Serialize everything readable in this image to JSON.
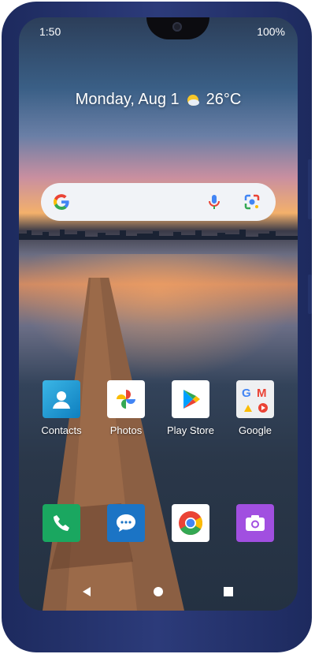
{
  "status_bar": {
    "time": "1:50",
    "battery": "100%"
  },
  "widget": {
    "date": "Monday, Aug 1",
    "temperature": "26°C",
    "weather_icon": "partly-sunny-icon"
  },
  "search_bar": {
    "icons": [
      "google-g-icon",
      "mic-icon",
      "google-lens-icon"
    ]
  },
  "home_apps": [
    {
      "label": "Contacts",
      "icon": "contacts-icon"
    },
    {
      "label": "Photos",
      "icon": "photos-icon"
    },
    {
      "label": "Play Store",
      "icon": "play-store-icon"
    },
    {
      "label": "Google",
      "icon": "google-folder-icon"
    }
  ],
  "dock_apps": [
    {
      "name": "Phone",
      "icon": "phone-icon"
    },
    {
      "name": "Messages",
      "icon": "messages-icon"
    },
    {
      "name": "Chrome",
      "icon": "chrome-icon"
    },
    {
      "name": "Camera",
      "icon": "camera-icon"
    }
  ],
  "nav_buttons": [
    "back-icon",
    "home-icon",
    "recents-icon"
  ],
  "colors": {
    "frame": "#24336b",
    "search_bg": "#f1f3f7",
    "phone_green": "#1aa760",
    "messages_blue": "#1b74c5",
    "camera_purple": "#a14fe0"
  }
}
